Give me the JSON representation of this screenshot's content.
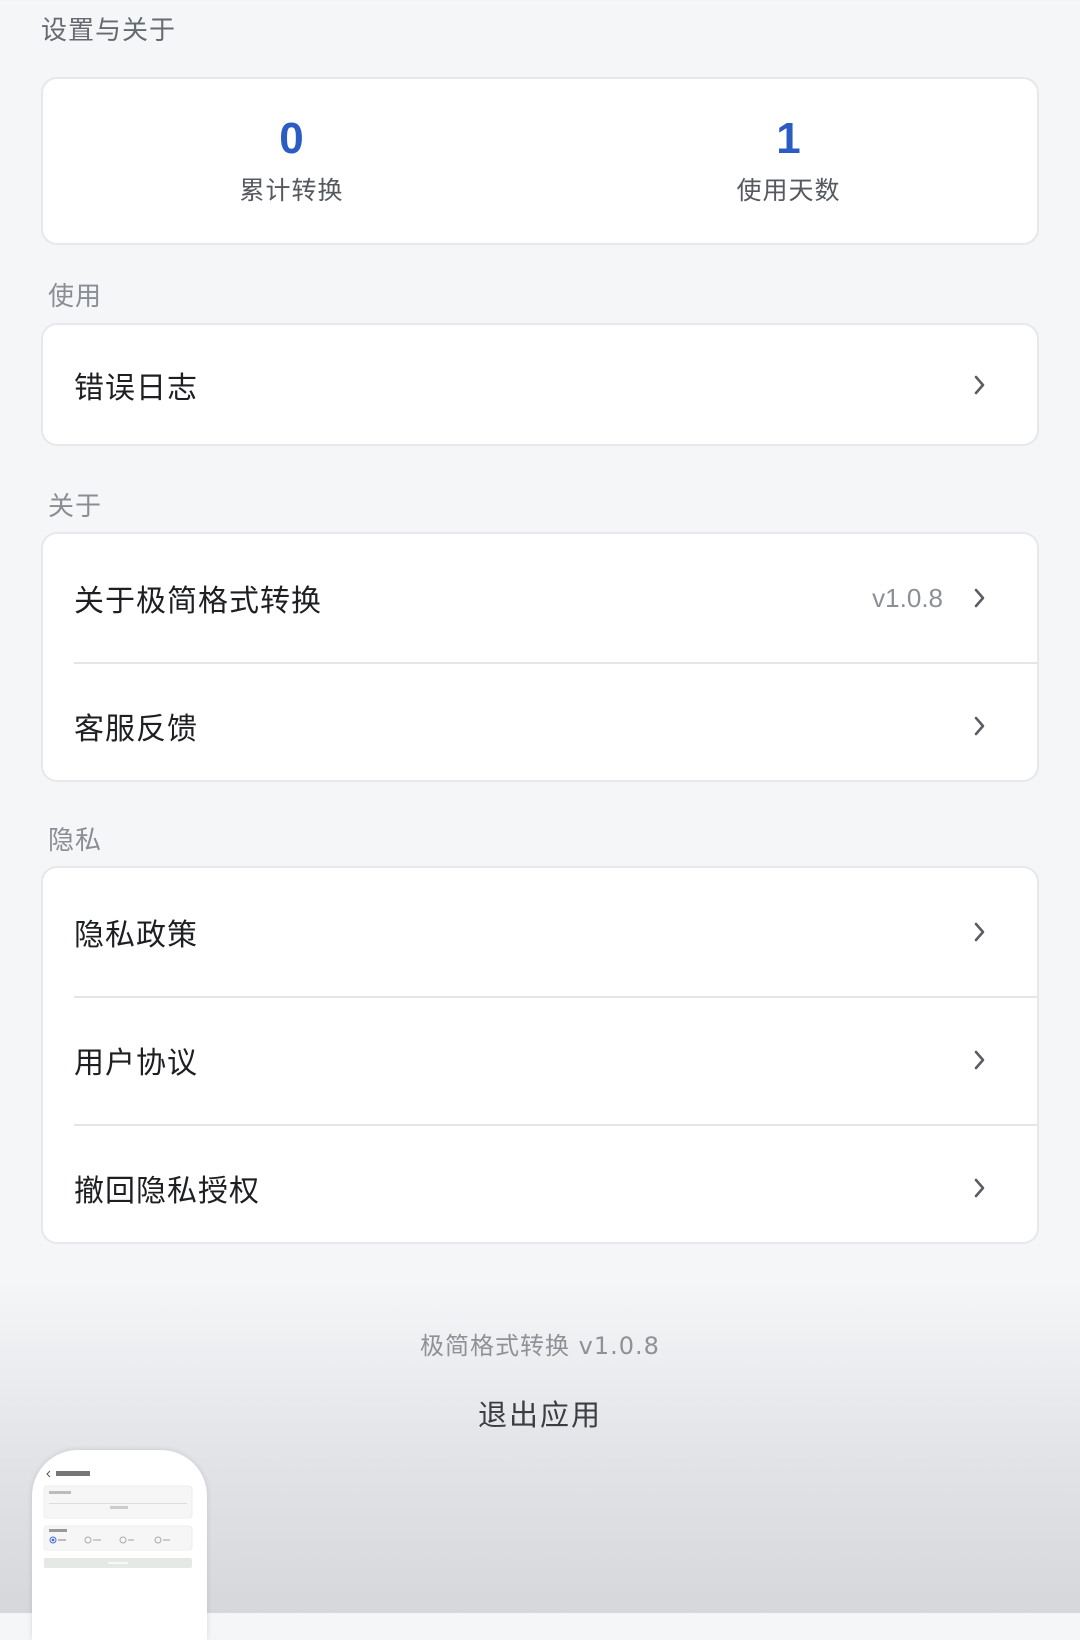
{
  "header": {
    "title": "设置与关于"
  },
  "stats": [
    {
      "value": "0",
      "label": "累计转换"
    },
    {
      "value": "1",
      "label": "使用天数"
    }
  ],
  "sections": {
    "usage": {
      "label": "使用",
      "items": [
        {
          "label": "错误日志"
        }
      ]
    },
    "about": {
      "label": "关于",
      "items": [
        {
          "label": "关于极简格式转换",
          "value": "v1.0.8"
        },
        {
          "label": "客服反馈"
        }
      ]
    },
    "privacy": {
      "label": "隐私",
      "items": [
        {
          "label": "隐私政策"
        },
        {
          "label": "用户协议"
        },
        {
          "label": "撤回隐私授权"
        }
      ]
    }
  },
  "footer": {
    "version_text": "极简格式转换 v1.0.8",
    "exit_label": "退出应用"
  },
  "icons": {
    "chevron": "chevron-right-icon"
  },
  "colors": {
    "accent": "#2b5cc4",
    "background": "#f5f6f8",
    "card": "#ffffff"
  }
}
